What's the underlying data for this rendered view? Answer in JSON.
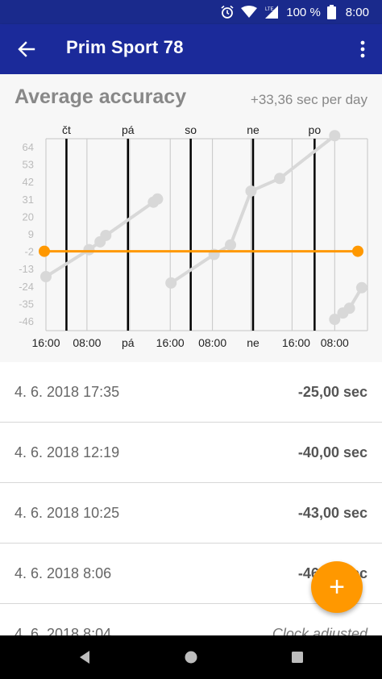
{
  "status_bar": {
    "battery": "100 %",
    "time": "8:00",
    "network": "LTE"
  },
  "app_bar": {
    "title": "Prim Sport 78"
  },
  "card": {
    "title": "Average accuracy",
    "rate": "+33,36 sec per day"
  },
  "chart_data": {
    "type": "line",
    "title": "Average accuracy",
    "y_ticks": [
      64,
      53,
      42,
      31,
      20,
      9,
      -2,
      -13,
      -24,
      -35,
      -46
    ],
    "ylim": [
      -46,
      64
    ],
    "x_labels_bottom": [
      "16:00",
      "08:00",
      "pá",
      "16:00",
      "08:00",
      "ne",
      "16:00",
      "08:00"
    ],
    "x_labels_top": [
      "čt",
      "pá",
      "so",
      "ne",
      "po"
    ],
    "series": [
      {
        "values_xy": [
          [
            0,
            -18
          ],
          [
            1.05,
            -1
          ],
          [
            1.32,
            4
          ],
          [
            1.46,
            8
          ],
          [
            2.62,
            29
          ],
          [
            2.72,
            31
          ]
        ]
      },
      {
        "values_xy": [
          [
            3.05,
            -22
          ],
          [
            4.1,
            -4
          ],
          [
            4.5,
            2
          ],
          [
            5.0,
            36
          ],
          [
            5.7,
            44
          ]
        ]
      },
      {
        "values_xy": [
          [
            7.04,
            -45
          ],
          [
            7.24,
            -41
          ],
          [
            7.4,
            -38
          ],
          [
            7.7,
            -25
          ],
          [
            7.04,
            71
          ]
        ]
      }
    ],
    "trend": {
      "y": -2
    },
    "colors": {
      "trend": "#ff9800",
      "points": "#d8d8d8",
      "major_grid": "#000000",
      "minor_grid": "#c6c6c6"
    }
  },
  "measurements": [
    {
      "date": "4. 6. 2018 17:35",
      "value": "-25,00 sec"
    },
    {
      "date": "4. 6. 2018 12:19",
      "value": "-40,00 sec"
    },
    {
      "date": "4. 6. 2018 10:25",
      "value": "-43,00 sec"
    },
    {
      "date": "4. 6. 2018 8:06",
      "value": "-46,00 sec"
    },
    {
      "date": "4. 6. 2018 8:04",
      "value": "Clock adjusted"
    }
  ],
  "fab": {
    "label": "+",
    "color": "#ff9800"
  },
  "colors": {
    "status_bar": "#1a2a8c",
    "app_bar": "#1b2a9a"
  }
}
